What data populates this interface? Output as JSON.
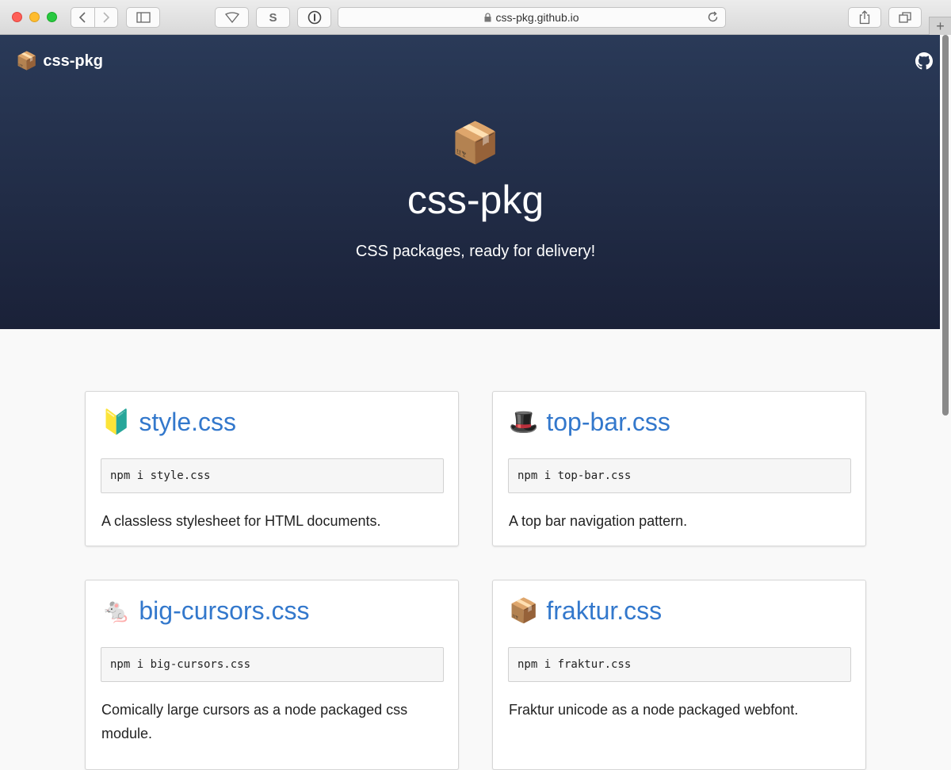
{
  "browser": {
    "url": "css-pkg.github.io"
  },
  "header": {
    "brand": "css-pkg",
    "brand_emoji": "📦",
    "github_icon": "github-icon"
  },
  "hero": {
    "emoji": "📦",
    "title": "css-pkg",
    "subtitle": "CSS packages, ready for delivery!"
  },
  "packages": [
    {
      "emoji": "🔰",
      "name": "style.css",
      "install": "npm i style.css",
      "description": "A classless stylesheet for HTML documents."
    },
    {
      "emoji": "🎩",
      "name": "top-bar.css",
      "install": "npm i top-bar.css",
      "description": "A top bar navigation pattern."
    },
    {
      "emoji": "🐁",
      "name": "big-cursors.css",
      "install": "npm i big-cursors.css",
      "description": "Comically large cursors as a node packaged css module."
    },
    {
      "emoji": "📦",
      "name": "fraktur.css",
      "install": "npm i fraktur.css",
      "description": "Fraktur unicode as a node packaged webfont."
    }
  ],
  "colors": {
    "hero_top": "#2a3a58",
    "hero_bottom": "#1a2138",
    "link": "#3378cc"
  }
}
